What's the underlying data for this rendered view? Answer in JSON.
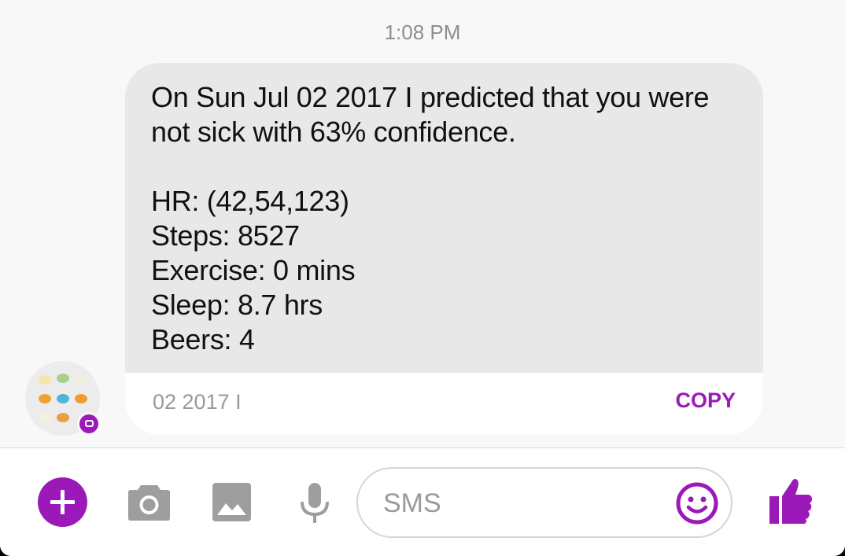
{
  "conversation": {
    "timestamp": "1:08 PM",
    "message": {
      "text": "On Sun Jul 02 2017 I predicted that you were\nnot sick with 63% confidence.\n\nHR: (42,54,123)\nSteps: 8527\nExercise: 0 mins\nSleep: 8.7 hrs\nBeers: 4",
      "selected_snippet": "02 2017 I",
      "copy_label": "COPY"
    },
    "avatar": {
      "icon": "contact-avatar-icon",
      "badge_icon": "messenger-badge-icon"
    }
  },
  "composer": {
    "add_icon": "plus-icon",
    "camera_icon": "camera-icon",
    "gallery_icon": "image-icon",
    "mic_icon": "microphone-icon",
    "input_placeholder": "SMS",
    "input_value": "",
    "emoji_icon": "smiley-icon",
    "like_icon": "thumbs-up-icon"
  },
  "colors": {
    "accent": "#9b19b8",
    "bubble_bg": "#e8e8e8",
    "icon_gray": "#9e9e9e"
  }
}
